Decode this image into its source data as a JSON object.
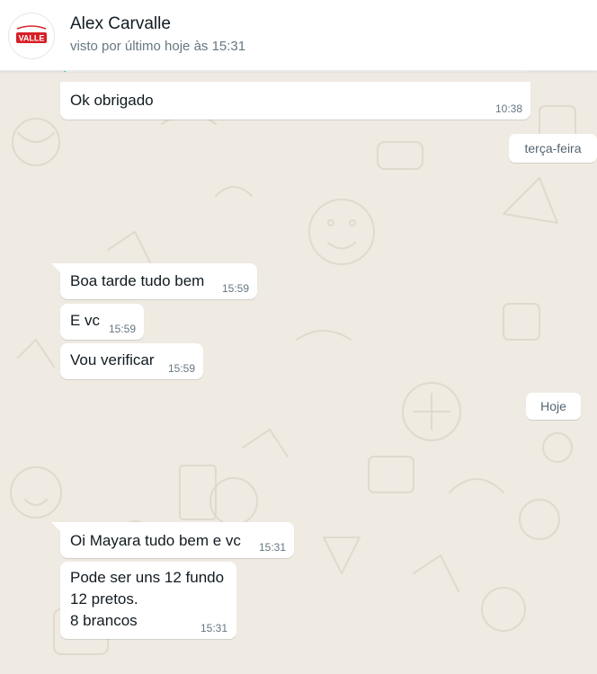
{
  "header": {
    "avatar_text": "VALLE",
    "contact_name": "Alex Carvalle",
    "last_seen": "visto por último hoje às 15:31"
  },
  "chat": {
    "prev_message": {
      "text": "Ok obrigado",
      "time": "10:38"
    },
    "day_tuesday": "terça-feira",
    "tuesday_messages": [
      {
        "text": "Boa tarde tudo bem",
        "time": "15:59"
      },
      {
        "text": "E vc",
        "time": "15:59"
      },
      {
        "text": "Vou verificar",
        "time": "15:59"
      }
    ],
    "day_today": "Hoje",
    "today_messages": [
      {
        "text": "Oi Mayara tudo bem e vc",
        "time": "15:31"
      },
      {
        "text": "Pode ser uns 12 fundo\n12 pretos.\n8 brancos",
        "time": "15:31"
      }
    ]
  },
  "colors": {
    "chat_background": "#efeae2",
    "bubble": "#ffffff",
    "quote_accent": "#06cf9c",
    "brand_red": "#d71f26"
  }
}
